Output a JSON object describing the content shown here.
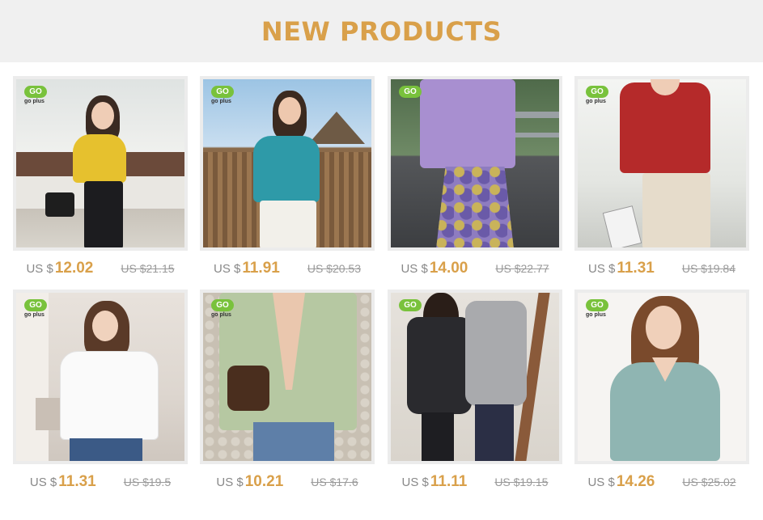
{
  "banner": {
    "title": "NEW PRODUCTS"
  },
  "logo": {
    "badge": "GO",
    "text": "go plus"
  },
  "products": [
    {
      "currency": "US $",
      "price": "12.02",
      "original": "US $21.15",
      "color": "#e6c12e"
    },
    {
      "currency": "US $",
      "price": "11.91",
      "original": "US $20.53",
      "color": "#2e9aa8"
    },
    {
      "currency": "US $",
      "price": "14.00",
      "original": "US $22.77",
      "color": "#a88fd0"
    },
    {
      "currency": "US $",
      "price": "11.31",
      "original": "US $19.84",
      "color": "#b52a2a"
    },
    {
      "currency": "US $",
      "price": "11.31",
      "original": "US $19.5",
      "color": "#fafafa"
    },
    {
      "currency": "US $",
      "price": "10.21",
      "original": "US $17.6",
      "color": "#b6c8a2"
    },
    {
      "currency": "US $",
      "price": "11.11",
      "original": "US $19.15",
      "color": "#2a2a2e"
    },
    {
      "currency": "US $",
      "price": "14.26",
      "original": "US $25.02",
      "color": "#8fb5b2"
    }
  ]
}
